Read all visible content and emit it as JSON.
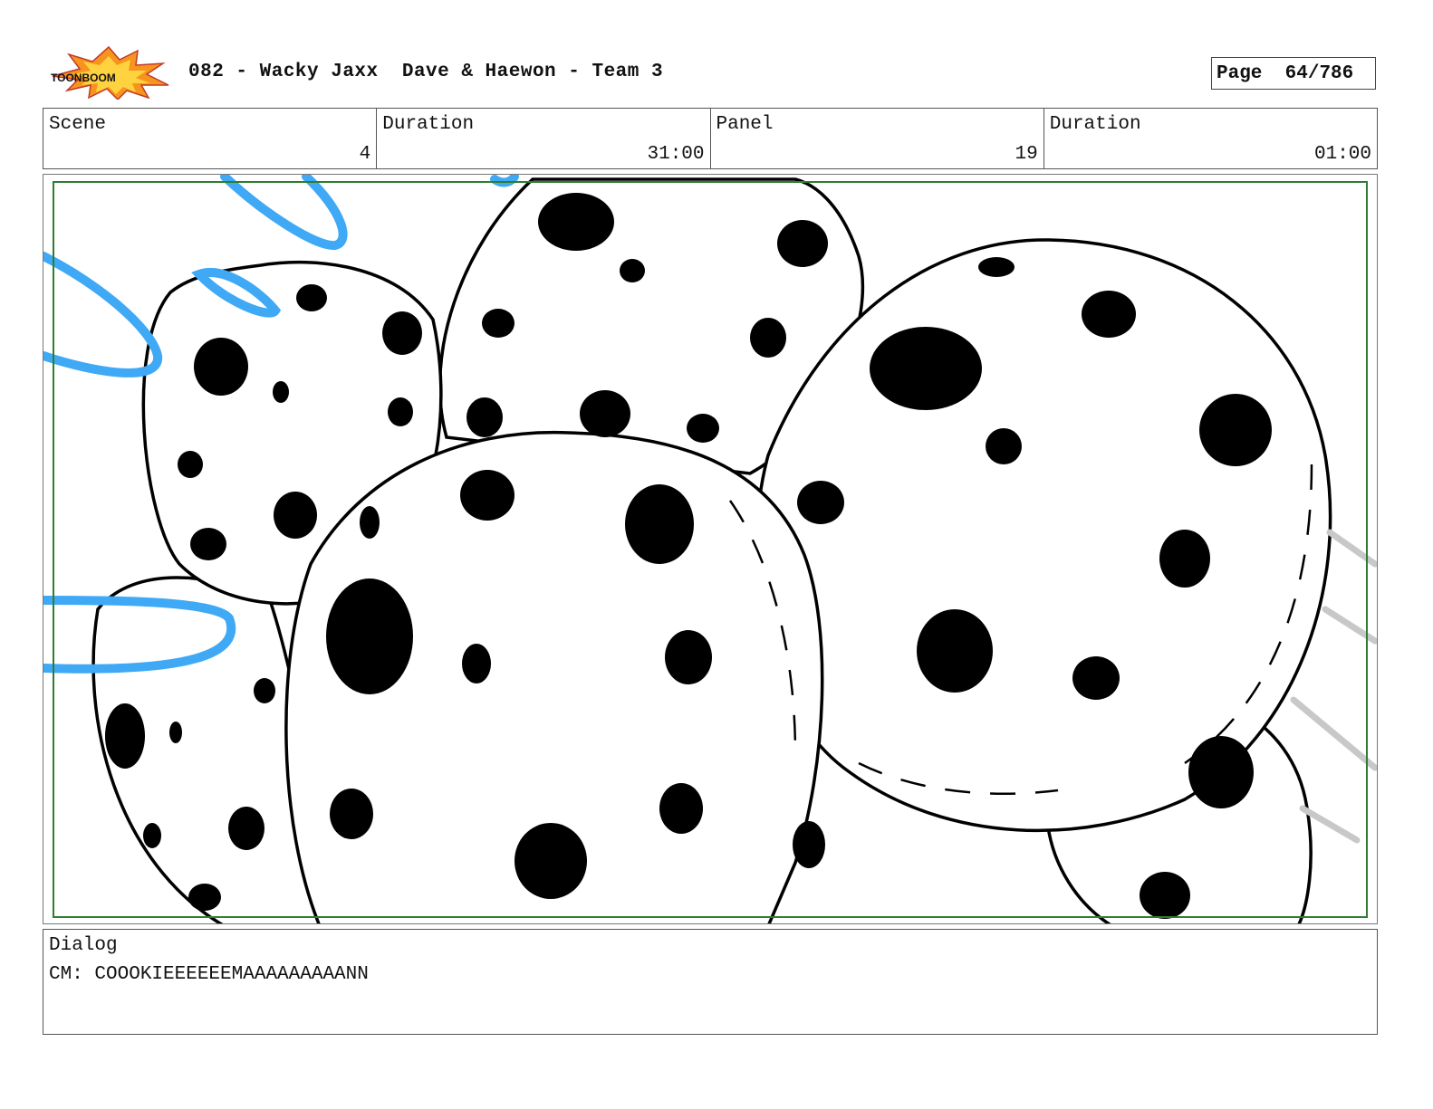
{
  "header": {
    "logo_text": "TOONBOOM",
    "title": "082 - Wacky Jaxx  Dave & Haewon - Team 3",
    "page_label": "Page",
    "page_value": "64/786"
  },
  "info": {
    "scene_label": "Scene",
    "scene_value": "4",
    "scene_duration_label": "Duration",
    "scene_duration_value": "31:00",
    "panel_label": "Panel",
    "panel_value": "19",
    "panel_duration_label": "Duration",
    "panel_duration_value": "01:00"
  },
  "dialog": {
    "label": "Dialog",
    "lines": [
      "CM: COOOKIEEEEEEMAAAAAAAAANN"
    ]
  },
  "colors": {
    "safe_frame": "#2e7d32",
    "motion_lines_blue": "#3fa9f5",
    "speed_lines_gray": "#c8c8c8"
  }
}
